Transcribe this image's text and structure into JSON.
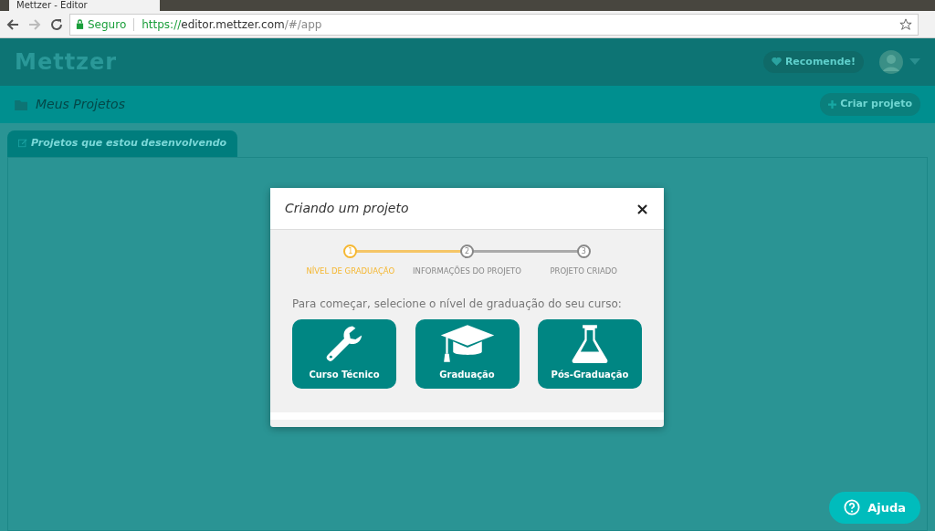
{
  "browser": {
    "tab_title": "Mettzer - Editor",
    "security": "Seguro",
    "url": {
      "scheme": "https://",
      "host": "editor.mettzer.com",
      "path": "/#/app"
    }
  },
  "header": {
    "logo": "Mettzer",
    "recommend": "Recomende!"
  },
  "subheader": {
    "title": "Meus Projetos",
    "create_button": "Criar projeto"
  },
  "tabs": [
    {
      "label": "Projetos que estou desenvolvendo",
      "selected": true
    }
  ],
  "modal": {
    "title": "Criando um projeto",
    "close": "×",
    "steps": [
      {
        "number": "1",
        "label": "NÍVEL DE GRADUAÇÃO",
        "selected": true
      },
      {
        "number": "2",
        "label": "INFORMAÇÕES DO PROJETO",
        "selected": false
      },
      {
        "number": "3",
        "label": "PROJETO CRIADO",
        "selected": false
      }
    ],
    "prompt": "Para começar, selecione o nível de graduação do seu curso:",
    "options": [
      {
        "label": "Curso Técnico",
        "kind": "wrench"
      },
      {
        "label": "Graduação",
        "kind": "cap"
      },
      {
        "label": "Pós-Graduação",
        "kind": "flask"
      }
    ]
  },
  "help_button": "Ajuda"
}
